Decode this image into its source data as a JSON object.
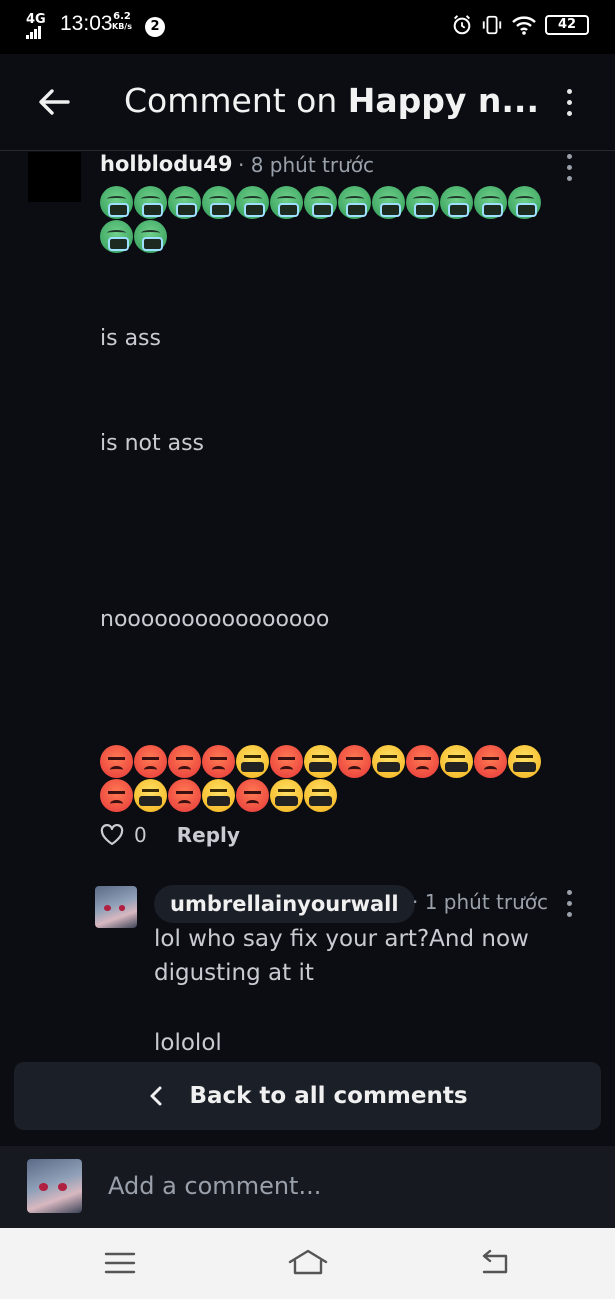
{
  "status_bar": {
    "network": "4G",
    "time": "13:03",
    "speed_value": "6.2",
    "speed_unit": "KB/s",
    "notification_count": "2",
    "battery": "42"
  },
  "header": {
    "title_prefix": "Comment on ",
    "title_bold": "Happy n..."
  },
  "comment": {
    "author": "holblodu49",
    "time_ago": "· 8 phút trước",
    "emoji_row1": [
      "sick",
      "sick",
      "sick",
      "sick",
      "sick",
      "sick",
      "sick",
      "sick",
      "sick",
      "sick",
      "sick",
      "sick",
      "sick"
    ],
    "emoji_row2": [
      "sick",
      "sick"
    ],
    "line1": "is ass",
    "line2": "is not ass",
    "line3": "noooooooooooooooo",
    "emoji_row3": [
      "angry",
      "angry",
      "angry",
      "angry",
      "curse",
      "angry",
      "curse",
      "angry",
      "curse",
      "angry",
      "curse",
      "angry",
      "curse"
    ],
    "emoji_row4": [
      "angry",
      "curse",
      "angry",
      "curse",
      "angry",
      "curse",
      "curse"
    ],
    "like_count": "0",
    "reply_label": "Reply"
  },
  "reply": {
    "author": "umbrellainyourwall",
    "time_ago": "· 1 phút trước",
    "line1": "lol who say fix your art?And now",
    "line2": "digusting at it",
    "line3": "lololol"
  },
  "back_to_all_label": "Back to all comments",
  "compose": {
    "placeholder": "Add a comment..."
  },
  "icons": {
    "back": "arrow-left-icon",
    "menu": "kebab-menu-icon",
    "like": "heart-outline-icon",
    "nav_menu": "hamburger-icon",
    "nav_home": "home-icon",
    "nav_back": "return-icon"
  }
}
